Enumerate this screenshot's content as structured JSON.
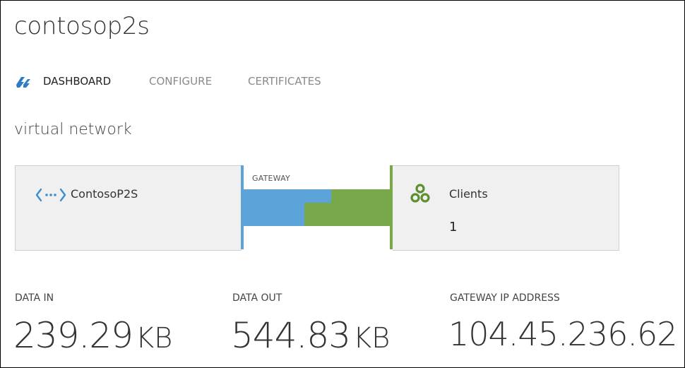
{
  "header": {
    "title": "contosop2s"
  },
  "tabs": [
    {
      "label": "DASHBOARD",
      "active": true
    },
    {
      "label": "CONFIGURE",
      "active": false
    },
    {
      "label": "CERTIFICATES",
      "active": false
    }
  ],
  "section": {
    "title": "virtual network"
  },
  "network": {
    "vnet_name": "ContosoP2S",
    "gateway_label": "GATEWAY",
    "clients_label": "Clients",
    "clients_count": "1"
  },
  "stats": {
    "data_in": {
      "label": "DATA IN",
      "value": "239.29",
      "unit": "KB"
    },
    "data_out": {
      "label": "DATA OUT",
      "value": "544.83",
      "unit": "KB"
    },
    "gateway_ip": {
      "label": "GATEWAY IP ADDRESS",
      "value": "104.45.236.62"
    }
  },
  "colors": {
    "blue": "#5ba3d9",
    "green": "#79a84a",
    "tab_logo": "#2e7dc4",
    "node_bg": "#f0f0f0"
  },
  "icons": {
    "tab_logo": "cloud-lightning-icon",
    "vnet": "virtual-network-icon",
    "clients": "clients-icon"
  }
}
